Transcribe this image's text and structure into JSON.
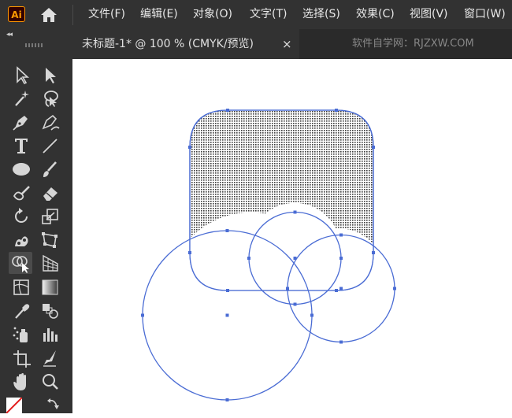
{
  "app": {
    "logo_text": "Ai",
    "home_icon": "home-icon",
    "accent": "#ff9a00"
  },
  "menu": {
    "items": [
      {
        "label": "文件(F)"
      },
      {
        "label": "编辑(E)"
      },
      {
        "label": "对象(O)"
      },
      {
        "label": "文字(T)"
      },
      {
        "label": "选择(S)"
      },
      {
        "label": "效果(C)"
      },
      {
        "label": "视图(V)"
      },
      {
        "label": "窗口(W)"
      }
    ]
  },
  "document_tab": {
    "title": "未标题-1* @ 100 % (CMYK/预览)",
    "close_glyph": "×"
  },
  "watermark": "软件自学网：RJZXW.COM",
  "toolbar": {
    "tools": [
      "selection-tool",
      "direct-selection-tool",
      "magic-wand-tool",
      "lasso-tool",
      "pen-tool",
      "curvature-tool",
      "type-tool",
      "line-segment-tool",
      "ellipse-tool",
      "paintbrush-tool",
      "shaper-tool",
      "eraser-tool",
      "rotate-tool",
      "scale-tool",
      "puppet-warp-tool",
      "free-transform-tool",
      "shape-builder-tool",
      "perspective-grid-tool",
      "mesh-tool",
      "gradient-tool",
      "eyedropper-tool",
      "blend-tool",
      "symbol-sprayer-tool",
      "column-graph-tool",
      "artboard-tool",
      "slice-tool",
      "hand-tool",
      "zoom-tool"
    ],
    "active_tool": "shape-builder-tool"
  },
  "canvas": {
    "selection_color": "#4a6cd4",
    "shapes": [
      "rounded-rectangle-filled-pattern",
      "large-circle",
      "middle-circle",
      "right-circle"
    ]
  },
  "colors": {
    "menubar_bg": "#323232",
    "toolbar_bg": "#323232",
    "tabbar_bg": "#2a2a2a",
    "canvas_bg": "#ffffff"
  }
}
